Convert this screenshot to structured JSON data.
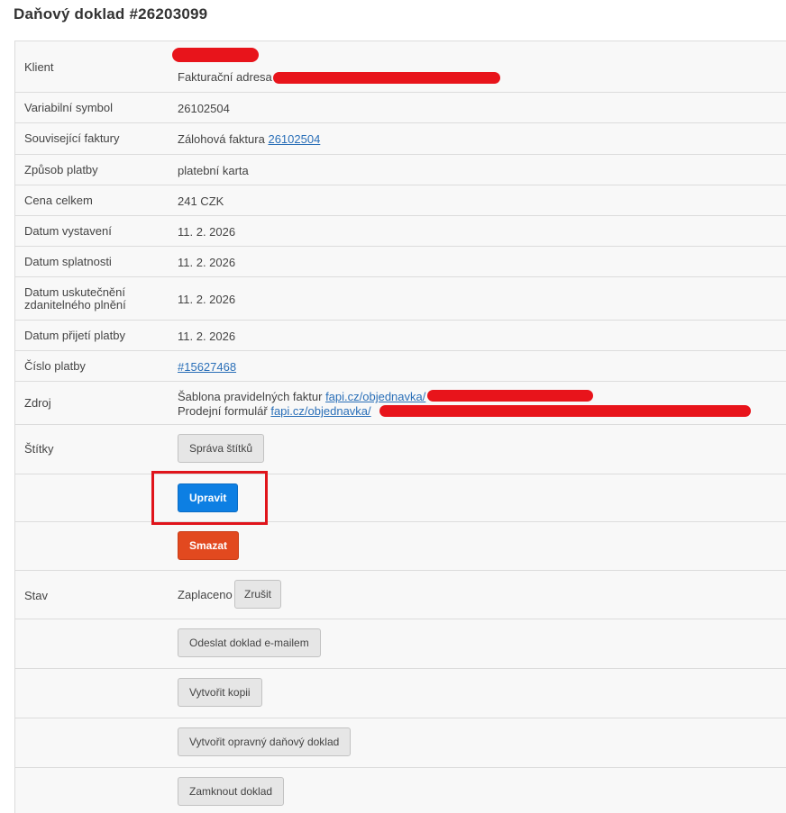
{
  "page": {
    "title": "Daňový doklad #26203099"
  },
  "rows": {
    "client": {
      "label": "Klient",
      "address_label": "Fakturační adresa"
    },
    "variable_symbol": {
      "label": "Variabilní symbol",
      "value": "26102504"
    },
    "related_invoices": {
      "label": "Související faktury",
      "prefix": "Zálohová faktura",
      "link": "26102504"
    },
    "payment_method": {
      "label": "Způsob platby",
      "value": "platební karta"
    },
    "total_price": {
      "label": "Cena celkem",
      "value": "241 CZK"
    },
    "issue_date": {
      "label": "Datum vystavení",
      "value": "11. 2. 2026"
    },
    "due_date": {
      "label": "Datum splatnosti",
      "value": "11. 2. 2026"
    },
    "taxable_date": {
      "label": "Datum uskutečnění zdanitelného plnění",
      "label_line1": "Datum uskutečnění",
      "label_line2": "zdanitelného plnění",
      "value": "11. 2. 2026"
    },
    "payment_received_date": {
      "label": "Datum přijetí platby",
      "value": "11. 2. 2026"
    },
    "payment_number": {
      "label": "Číslo platby",
      "link": "#15627468"
    },
    "source": {
      "label": "Zdroj",
      "line1_prefix": "Šablona pravidelných faktur",
      "line1_link": "fapi.cz/objednavka/",
      "line2_prefix": "Prodejní formulář",
      "line2_link": "fapi.cz/objednavka/"
    },
    "tags": {
      "label": "Štítky",
      "button": "Správa štítků"
    },
    "edit": {
      "button": "Upravit"
    },
    "delete": {
      "button": "Smazat"
    },
    "status": {
      "label": "Stav",
      "value": "Zaplaceno",
      "button": "Zrušit"
    },
    "send_email": {
      "button": "Odeslat doklad e-mailem"
    },
    "create_copy": {
      "button": "Vytvořit kopii"
    },
    "create_correction": {
      "button": "Vytvořit opravný daňový doklad"
    },
    "lock": {
      "button": "Zamknout doklad"
    }
  },
  "colors": {
    "primary_button": "#0d7fe3",
    "danger_button": "#e2491f",
    "link": "#2a6fb8",
    "redaction": "#e8141b",
    "highlight_box": "#e0141b"
  }
}
